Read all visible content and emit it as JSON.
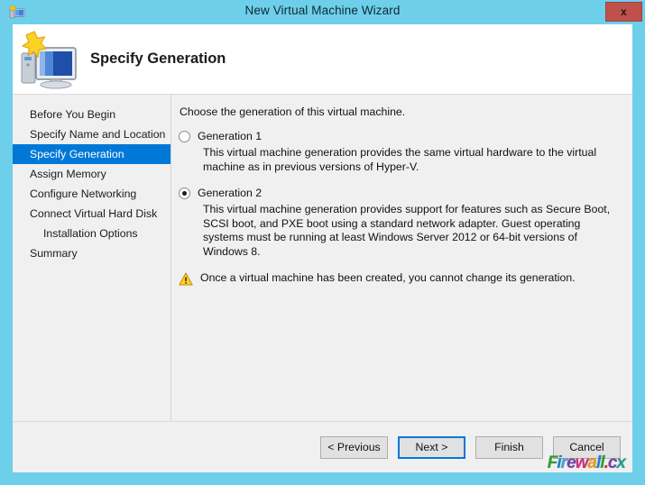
{
  "window": {
    "title": "New Virtual Machine Wizard",
    "icon": "vm-wizard-icon",
    "close_label": "x"
  },
  "banner": {
    "icon": "computer-monitor-star-icon",
    "title": "Specify Generation"
  },
  "sidebar": {
    "items": [
      {
        "label": "Before You Begin",
        "selected": false,
        "indented": false
      },
      {
        "label": "Specify Name and Location",
        "selected": false,
        "indented": false
      },
      {
        "label": "Specify Generation",
        "selected": true,
        "indented": false
      },
      {
        "label": "Assign Memory",
        "selected": false,
        "indented": false
      },
      {
        "label": "Configure Networking",
        "selected": false,
        "indented": false
      },
      {
        "label": "Connect Virtual Hard Disk",
        "selected": false,
        "indented": false
      },
      {
        "label": "Installation Options",
        "selected": false,
        "indented": true
      },
      {
        "label": "Summary",
        "selected": false,
        "indented": false
      }
    ]
  },
  "content": {
    "intro": "Choose the generation of this virtual machine.",
    "options": [
      {
        "label": "Generation 1",
        "checked": false,
        "description": "This virtual machine generation provides the same virtual hardware to the virtual machine as in previous versions of Hyper-V."
      },
      {
        "label": "Generation 2",
        "checked": true,
        "description": "This virtual machine generation provides support for features such as Secure Boot, SCSI boot, and PXE boot using a standard network adapter. Guest operating systems must be running at least Windows Server 2012 or 64-bit versions of Windows 8."
      }
    ],
    "warning": {
      "icon": "warning-triangle-icon",
      "text": "Once a virtual machine has been created, you cannot change its generation."
    }
  },
  "footer": {
    "buttons": [
      {
        "label": "< Previous",
        "focused": false
      },
      {
        "label": "Next >",
        "focused": true
      },
      {
        "label": "Finish",
        "focused": false
      },
      {
        "label": "Cancel",
        "focused": false
      }
    ]
  },
  "watermark": {
    "letters": [
      {
        "char": "F",
        "color": "#2f9e2f"
      },
      {
        "char": "i",
        "color": "#1f7fd0"
      },
      {
        "char": "r",
        "color": "#3aa3e0"
      },
      {
        "char": "e",
        "color": "#7d3fa8"
      },
      {
        "char": "w",
        "color": "#d12f7a"
      },
      {
        "char": "a",
        "color": "#e0a020"
      },
      {
        "char": "l",
        "color": "#1f7fd0"
      },
      {
        "char": "l",
        "color": "#2f9e2f"
      },
      {
        "char": ".",
        "color": "#d12f2f"
      },
      {
        "char": "c",
        "color": "#7d3fa8"
      },
      {
        "char": "x",
        "color": "#1f9e8f"
      }
    ]
  },
  "colors": {
    "window_chrome": "#6ECFEA",
    "accent": "#0078D7",
    "dialog_bg": "#F0F0F0",
    "close_button": "#C0504C"
  }
}
